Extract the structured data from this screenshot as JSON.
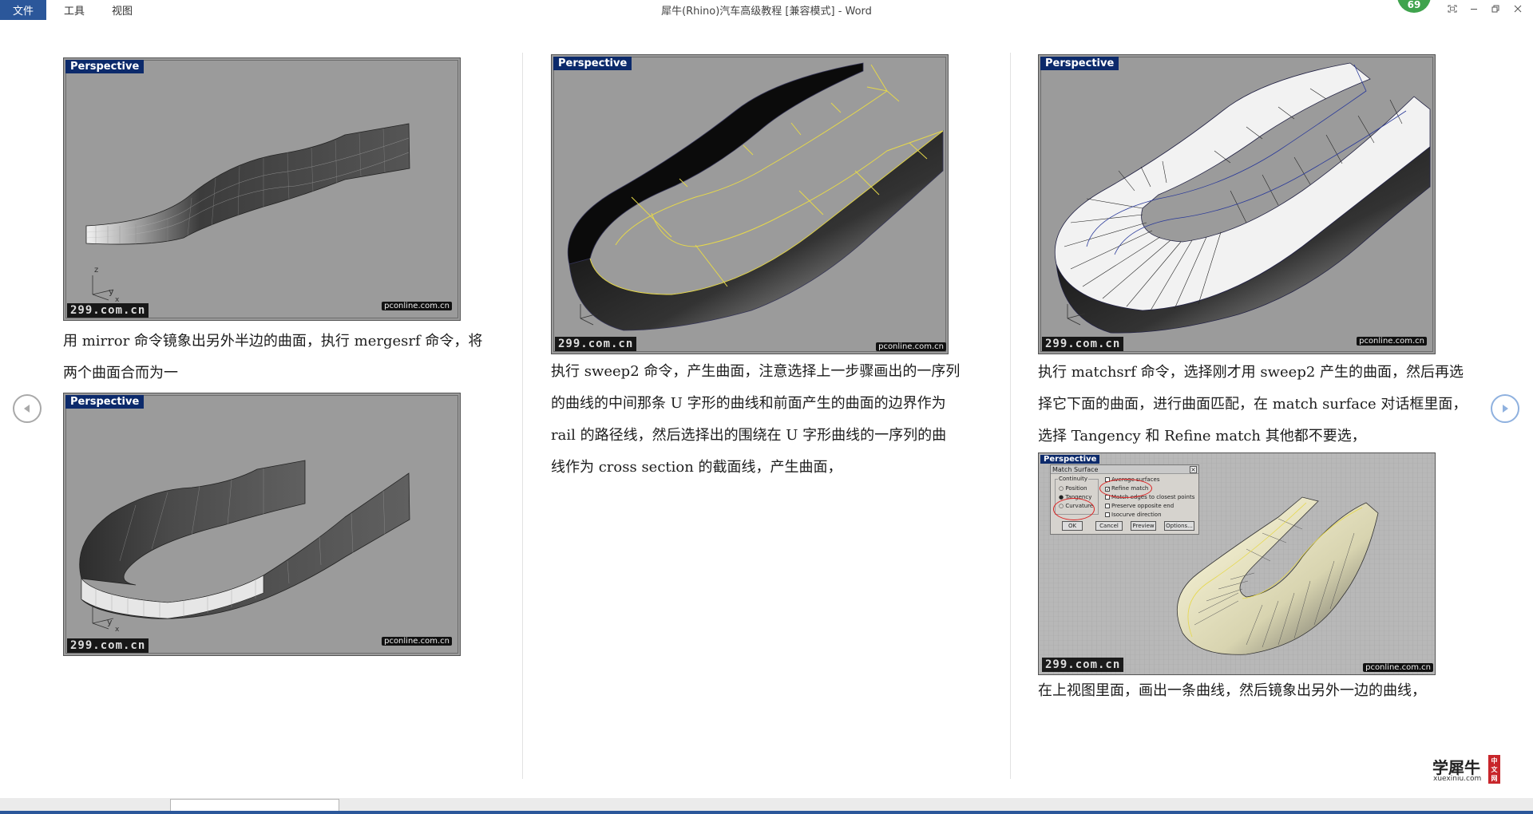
{
  "titlebar": {
    "menu": [
      "文件",
      "工具",
      "视图"
    ],
    "title": "犀牛(Rhino)汽车高级教程 [兼容模式] - Word",
    "badge": "69"
  },
  "figures": {
    "fig1": {
      "label": "Perspective",
      "wm_left": "299.com.cn",
      "wm_right": "pconline.com.cn"
    },
    "fig2": {
      "label": "Perspective",
      "wm_left": "299.com.cn",
      "wm_right": "pconline.com.cn"
    },
    "fig3": {
      "label": "Perspective",
      "wm_left": "299.com.cn",
      "wm_right": "pconline.com.cn"
    },
    "fig4": {
      "label": "Perspective",
      "wm_left": "299.com.cn",
      "wm_right": "pconline.com.cn"
    },
    "fig5": {
      "label": "Perspective",
      "wm_left": "299.com.cn",
      "wm_right": "pconline.com.cn"
    }
  },
  "paragraphs": {
    "left": [
      "用 mirror 命令镜象出另外半边的曲面，执行 mergesrf 命令，将",
      "两个曲面合而为一"
    ],
    "middle": [
      "执行 sweep2 命令，产生曲面，注意选择上一步骤画出的一序列",
      "的曲线的中间那条 U 字形的曲线和前面产生的曲面的边界作为",
      "rail 的路径线，然后选择出的围绕在 U 字形曲线的一序列的曲",
      "线作为 cross section 的截面线，产生曲面，"
    ],
    "right_top": [
      "执行 matchsrf 命令，选择刚才用 sweep2 产生的曲面，然后再选",
      "择它下面的曲面，进行曲面匹配，在 match surface 对话框里面，",
      "选择 Tangency 和 Refine match 其他都不要选，"
    ],
    "right_bottom": [
      "在上视图里面，画出一条曲线，然后镜象出另外一边的曲线，"
    ]
  },
  "dialog": {
    "title": "Match Surface",
    "group": "Continuity",
    "options": [
      "Position",
      "Tangency",
      "Curvature"
    ],
    "checks": [
      "Average surfaces",
      "Refine match",
      "Match edges to closest points",
      "Preserve opposite end",
      "Isocurve direction"
    ],
    "buttons": [
      "OK",
      "Cancel",
      "Preview",
      "Options..."
    ]
  },
  "logo": {
    "cn": "学犀牛",
    "en": "xuexiniu.com",
    "tag": "中文网"
  },
  "colors": {
    "accent": "#2b579a",
    "label_bg": "#0c2a6b",
    "viewport_bg": "#9b9b9b",
    "badge": "#3fa34d",
    "curve": "#e6d84a"
  }
}
